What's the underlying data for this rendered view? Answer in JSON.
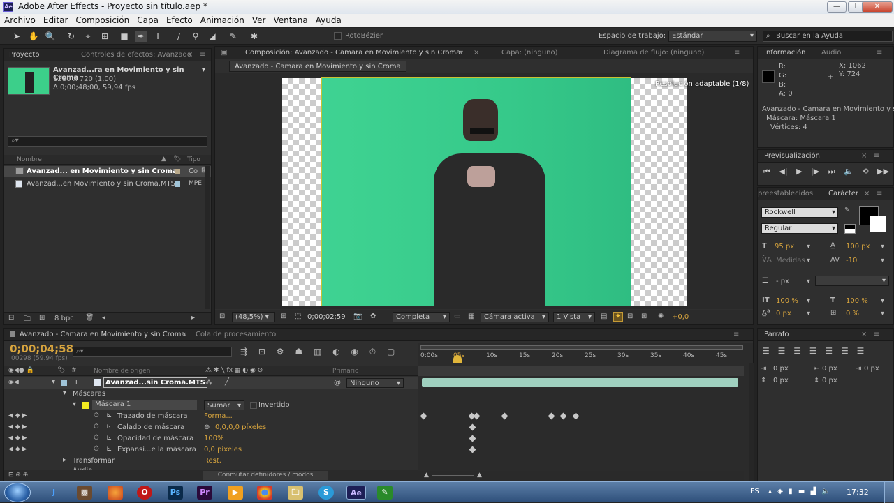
{
  "window": {
    "title": "Adobe After Effects - Proyecto sin título.aep *",
    "app_icon": "Ae"
  },
  "menu": [
    "Archivo",
    "Editar",
    "Composición",
    "Capa",
    "Efecto",
    "Animación",
    "Ver",
    "Ventana",
    "Ayuda"
  ],
  "toolbar": {
    "rotobezier": "RotoBézier",
    "workspace_label": "Espacio de trabajo:",
    "workspace_value": "Estándar",
    "help_placeholder": "Buscar en la Ayuda"
  },
  "project": {
    "tab": "Proyecto",
    "tab2": "Controles de efectos: Avanzado",
    "thumb_name": "Avanzad...ra en Movimiento y sin Croma",
    "thumb_size": "1280 x 720 (1,00)",
    "thumb_duration": "Δ 0;00;48;00, 59,94 fps",
    "col_name": "Nombre",
    "col_type": "Tipo",
    "items": [
      {
        "name": "Avanzad... en Movimiento y sin Croma",
        "type": "Co"
      },
      {
        "name": "Avanzad...en Movimiento y sin Croma.MTS",
        "type": "MPE"
      }
    ],
    "bpc": "8 bpc"
  },
  "comp": {
    "tab": "Composición: Avanzado - Camara en Movimiento y sin Croma",
    "layer_tab": "Capa: (ninguno)",
    "flow_tab": "Diagrama de flujo: (ninguno)",
    "breadcrumb": "Avanzado - Camara en Movimiento y sin Croma",
    "resolution_note": "Resolución adaptable (1/8)",
    "zoom": "(48,5%)",
    "timecode": "0;00;02;59",
    "quality": "Completa",
    "camera": "Cámara activa",
    "views": "1 Vista",
    "exposure": "+0,0"
  },
  "info": {
    "tab": "Información",
    "tab2": "Audio",
    "r": "R:",
    "g": "G:",
    "b": "B:",
    "a": "A:  0",
    "x": "X:  1062",
    "y": "Y:  724",
    "line1": "Avanzado - Camara en Movimiento y sin Croma",
    "line2": "Máscara: Máscara 1",
    "line3": "Vértices: 4"
  },
  "preview": {
    "tab": "Previsualización"
  },
  "character": {
    "tab1": "preestablecidos",
    "tab2": "Carácter",
    "font": "Rockwell",
    "style": "Regular",
    "size": "95 px",
    "leading": "100 px",
    "kerning": "Medidas",
    "tracking": "-10",
    "stroke": "- px",
    "vscale": "100 %",
    "hscale": "100 %",
    "baseline": "0 px",
    "tsume": "0 %"
  },
  "paragraph": {
    "tab": "Párrafo",
    "indent1": "0 px",
    "indent2": "0 px",
    "indent3": "0 px",
    "space1": "0 px",
    "space2": "0 px"
  },
  "timeline": {
    "tab": "Avanzado - Camara en Movimiento y sin Croma",
    "tab2": "Cola de procesamiento",
    "timecode": "0;00;04;58",
    "frames": "00298 (59.94 fps)",
    "col_source": "Nombre de origen",
    "col_parent": "Primario",
    "ruler": [
      "0:00s",
      "05s",
      "10s",
      "15s",
      "20s",
      "25s",
      "30s",
      "35s",
      "40s",
      "45s"
    ],
    "layer": {
      "num": "1",
      "name": "Avanzad...sin Croma.MTS",
      "parent": "Ninguno"
    },
    "masks_label": "Máscaras",
    "mask_name": "Máscara 1",
    "mask_mode": "Sumar",
    "mask_inverted": "Invertido",
    "props": [
      {
        "name": "Trazado de máscara",
        "value": "Forma..."
      },
      {
        "name": "Calado de máscara",
        "value": "0,0,0,0  píxeles"
      },
      {
        "name": "Opacidad de máscara",
        "value": "100%"
      },
      {
        "name": "Expansi...e la máscara",
        "value": "0,0  píxeles"
      }
    ],
    "transform": "Transformar",
    "transform_value": "Rest.",
    "audio": "Audio",
    "toggle": "Conmutar definidores / modos"
  },
  "taskbar": {
    "lang": "ES",
    "time": "17:32"
  }
}
